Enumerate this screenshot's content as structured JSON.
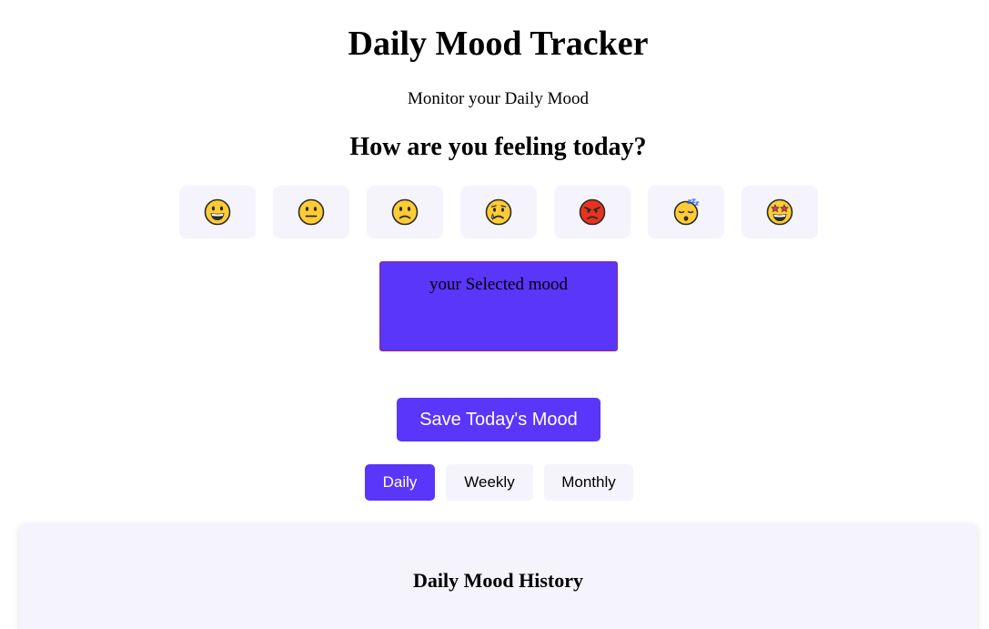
{
  "header": {
    "title": "Daily Mood Tracker",
    "subtitle": "Monitor your Daily Mood"
  },
  "mood_picker": {
    "question": "How are you feeling today?",
    "options": [
      {
        "icon": "grinning-face-icon"
      },
      {
        "icon": "neutral-face-icon"
      },
      {
        "icon": "slightly-frowning-face-icon"
      },
      {
        "icon": "crying-face-icon"
      },
      {
        "icon": "angry-face-icon"
      },
      {
        "icon": "sleeping-face-icon"
      },
      {
        "icon": "star-struck-face-icon"
      }
    ]
  },
  "selected_mood": {
    "text": "your Selected mood"
  },
  "save_button": {
    "label": "Save Today's Mood"
  },
  "tabs": [
    {
      "label": "Daily",
      "active": true
    },
    {
      "label": "Weekly",
      "active": false
    },
    {
      "label": "Monthly",
      "active": false
    }
  ],
  "history": {
    "title": "Daily Mood History"
  },
  "colors": {
    "accent": "#5a35fa",
    "button_bg": "#f5f4fd",
    "selected_border": "#9a2c6a"
  }
}
